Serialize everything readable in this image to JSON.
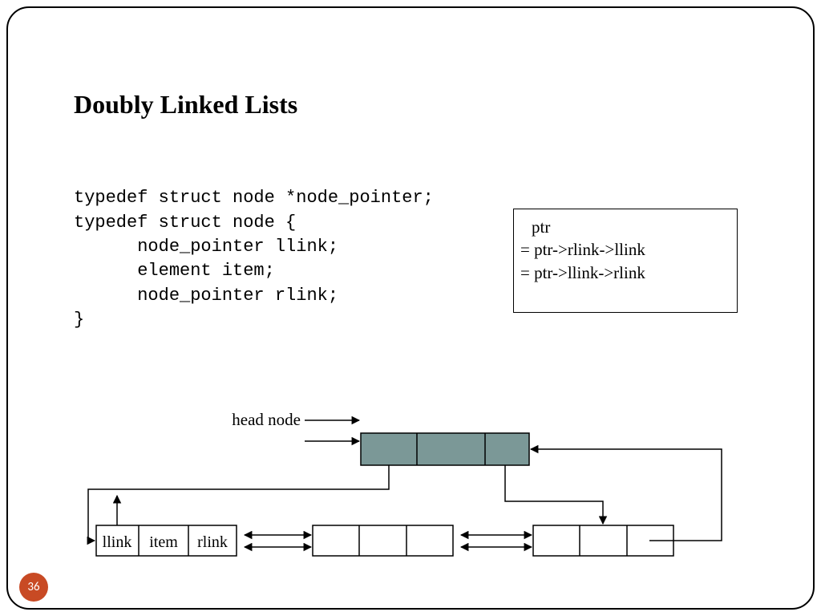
{
  "title": "Doubly Linked Lists",
  "code": {
    "l1": "typedef struct node *node_pointer;",
    "l2": "typedef struct node {",
    "l3": "      node_pointer llink;",
    "l4": "      element item;",
    "l5": "      node_pointer rlink;",
    "l6": "}"
  },
  "note": {
    "l1": "ptr",
    "l2": "= ptr->rlink->llink",
    "l3": "= ptr->llink->rlink"
  },
  "diagram": {
    "head_label": "head node",
    "field_llink": "llink",
    "field_item": "item",
    "field_rlink": "rlink"
  },
  "page_number": "36",
  "colors": {
    "head_fill": "#7b9897",
    "badge": "#c84a24"
  }
}
